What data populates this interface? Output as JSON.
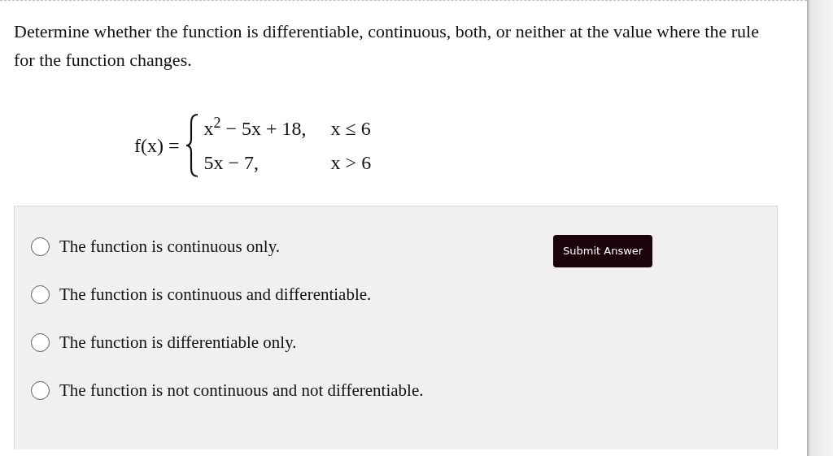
{
  "question": "Determine whether the function is differentiable, continuous, both, or neither at the value where the rule for the function changes.",
  "formula": {
    "lhs": "f(x) =",
    "cases": [
      {
        "expression": "x$^{2}$ − 5x + 18,",
        "condition": "x ≤ 6"
      },
      {
        "expression": "5x − 7,",
        "condition": "x > 6"
      }
    ]
  },
  "options": [
    {
      "label": "The function is continuous only.",
      "selected": false
    },
    {
      "label": "The function is continuous and differentiable.",
      "selected": false
    },
    {
      "label": "The function is differentiable only.",
      "selected": false
    },
    {
      "label": "The function is not continuous and not differentiable.",
      "selected": false
    }
  ],
  "submit_button": "Submit Answer"
}
